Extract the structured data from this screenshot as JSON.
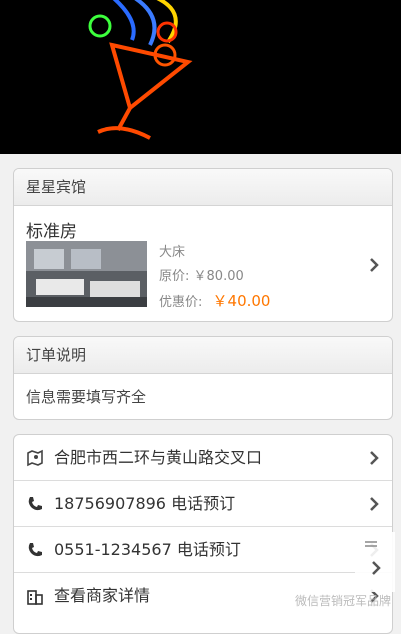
{
  "hotel": {
    "name": "星星宾馆",
    "room": {
      "title": "标准房",
      "bed": "大床",
      "original_price_label": "原价:",
      "original_price": "￥80.00",
      "sale_price_label": "优惠价:",
      "sale_price": "￥40.00"
    }
  },
  "order": {
    "title": "订单说明",
    "body": "信息需要填写齐全"
  },
  "info_list": [
    {
      "label": "合肥市西二环与黄山路交叉口",
      "icon": "map-icon"
    },
    {
      "label": "18756907896 电话预订",
      "icon": "phone-icon"
    },
    {
      "label": "0551-1234567 电话预订",
      "icon": "phone-icon"
    },
    {
      "label": "查看商家详情",
      "icon": "building-icon"
    }
  ],
  "watermark": "微信营销冠军品牌",
  "colors": {
    "sale_price": "#ff7700",
    "banner_bg": "#000000"
  }
}
